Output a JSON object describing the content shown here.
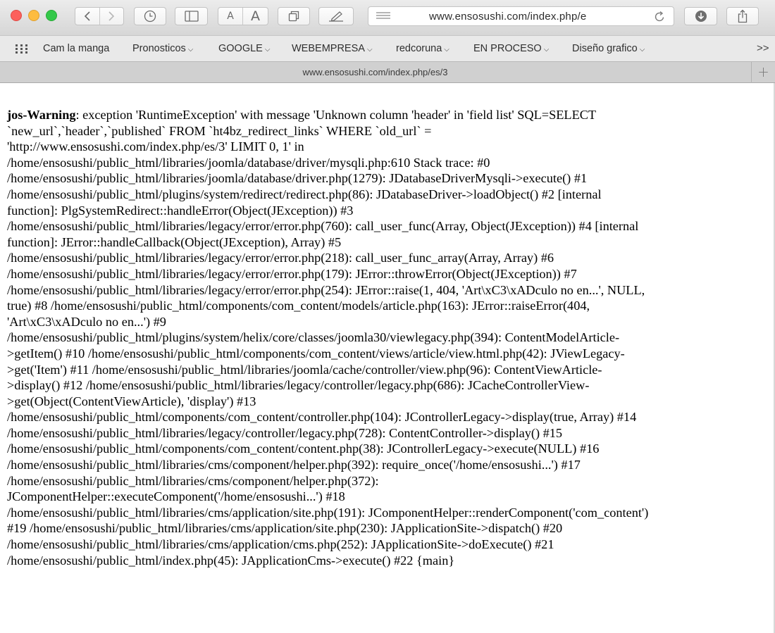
{
  "window": {
    "address": "www.ensosushi.com/index.php/e",
    "tab_title": "www.ensosushi.com/index.php/es/3",
    "font_small_label": "A",
    "font_large_label": "A"
  },
  "bookmarks": [
    {
      "label": "Cam la manga",
      "dropdown": false
    },
    {
      "label": "Pronosticos",
      "dropdown": true
    },
    {
      "label": "GOOGLE",
      "dropdown": true
    },
    {
      "label": "WEBEMPRESA",
      "dropdown": true
    },
    {
      "label": "redcoruna",
      "dropdown": true
    },
    {
      "label": "EN PROCESO",
      "dropdown": true
    },
    {
      "label": "Diseño grafico",
      "dropdown": true
    }
  ],
  "bookmarks_overflow": ">>",
  "new_tab_label": "+",
  "error": {
    "label": "jos-Warning",
    "lines": [
      ": exception 'RuntimeException' with message 'Unknown column 'header' in 'field list' SQL=SELECT",
      "`new_url`,`header`,`published` FROM `ht4bz_redirect_links` WHERE `old_url` =",
      "'http://www.ensosushi.com/index.php/es/3' LIMIT 0, 1' in",
      "/home/ensosushi/public_html/libraries/joomla/database/driver/mysqli.php:610 Stack trace: #0",
      "/home/ensosushi/public_html/libraries/joomla/database/driver.php(1279): JDatabaseDriverMysqli->execute() #1",
      "/home/ensosushi/public_html/plugins/system/redirect/redirect.php(86): JDatabaseDriver->loadObject() #2 [internal",
      "function]: PlgSystemRedirect::handleError(Object(JException)) #3",
      "/home/ensosushi/public_html/libraries/legacy/error/error.php(760): call_user_func(Array, Object(JException)) #4 [internal",
      "function]: JError::handleCallback(Object(JException), Array) #5",
      "/home/ensosushi/public_html/libraries/legacy/error/error.php(218): call_user_func_array(Array, Array) #6",
      "/home/ensosushi/public_html/libraries/legacy/error/error.php(179): JError::throwError(Object(JException)) #7",
      "/home/ensosushi/public_html/libraries/legacy/error/error.php(254): JError::raise(1, 404, 'Art\\xC3\\xADculo no en...', NULL,",
      "true) #8 /home/ensosushi/public_html/components/com_content/models/article.php(163): JError::raiseError(404,",
      "'Art\\xC3\\xADculo no en...') #9",
      "/home/ensosushi/public_html/plugins/system/helix/core/classes/joomla30/viewlegacy.php(394): ContentModelArticle-",
      ">getItem() #10 /home/ensosushi/public_html/components/com_content/views/article/view.html.php(42): JViewLegacy-",
      ">get('Item') #11 /home/ensosushi/public_html/libraries/joomla/cache/controller/view.php(96): ContentViewArticle-",
      ">display() #12 /home/ensosushi/public_html/libraries/legacy/controller/legacy.php(686): JCacheControllerView-",
      ">get(Object(ContentViewArticle), 'display') #13",
      "/home/ensosushi/public_html/components/com_content/controller.php(104): JControllerLegacy->display(true, Array) #14",
      "/home/ensosushi/public_html/libraries/legacy/controller/legacy.php(728): ContentController->display() #15",
      "/home/ensosushi/public_html/components/com_content/content.php(38): JControllerLegacy->execute(NULL) #16",
      "/home/ensosushi/public_html/libraries/cms/component/helper.php(392): require_once('/home/ensosushi...') #17",
      "/home/ensosushi/public_html/libraries/cms/component/helper.php(372):",
      "JComponentHelper::executeComponent('/home/ensosushi...') #18",
      "/home/ensosushi/public_html/libraries/cms/application/site.php(191): JComponentHelper::renderComponent('com_content')",
      "#19 /home/ensosushi/public_html/libraries/cms/application/site.php(230): JApplicationSite->dispatch() #20",
      "/home/ensosushi/public_html/libraries/cms/application/cms.php(252): JApplicationSite->doExecute() #21",
      "/home/ensosushi/public_html/index.php(45): JApplicationCms->execute() #22 {main}"
    ]
  }
}
